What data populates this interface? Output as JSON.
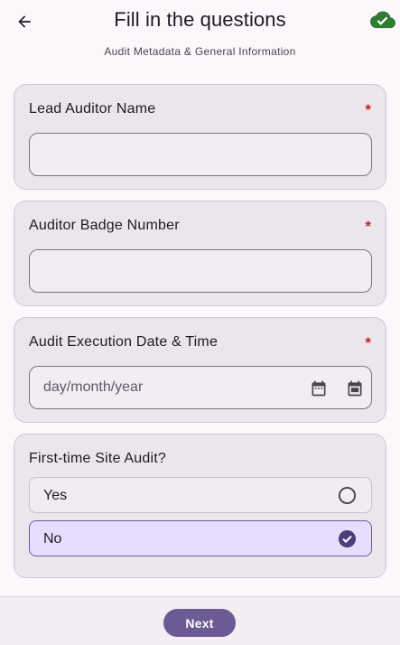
{
  "header": {
    "title": "Fill in the questions",
    "subtitle": "Audit Metadata & General Information",
    "back_icon": "arrow-left-icon",
    "sync_icon": "cloud-done-icon",
    "sync_color": "#2e7d32"
  },
  "fields": {
    "lead_auditor": {
      "label": "Lead Auditor Name",
      "required_mark": "*",
      "value": ""
    },
    "badge_number": {
      "label": "Auditor Badge Number",
      "required_mark": "*",
      "value": ""
    },
    "execution_datetime": {
      "label": "Audit Execution Date & Time",
      "required_mark": "*",
      "placeholder": "day/month/year",
      "icons": [
        "calendar-icon",
        "calendar-event-icon"
      ]
    },
    "first_time_audit": {
      "label": "First-time Site Audit?",
      "options": [
        {
          "label": "Yes",
          "selected": false
        },
        {
          "label": "No",
          "selected": true
        }
      ]
    }
  },
  "footer": {
    "next_label": "Next"
  },
  "colors": {
    "accent": "#6b5a93",
    "required": "#c4251f",
    "card_bg": "#ece6ec",
    "selected_bg": "#e8ddff"
  }
}
